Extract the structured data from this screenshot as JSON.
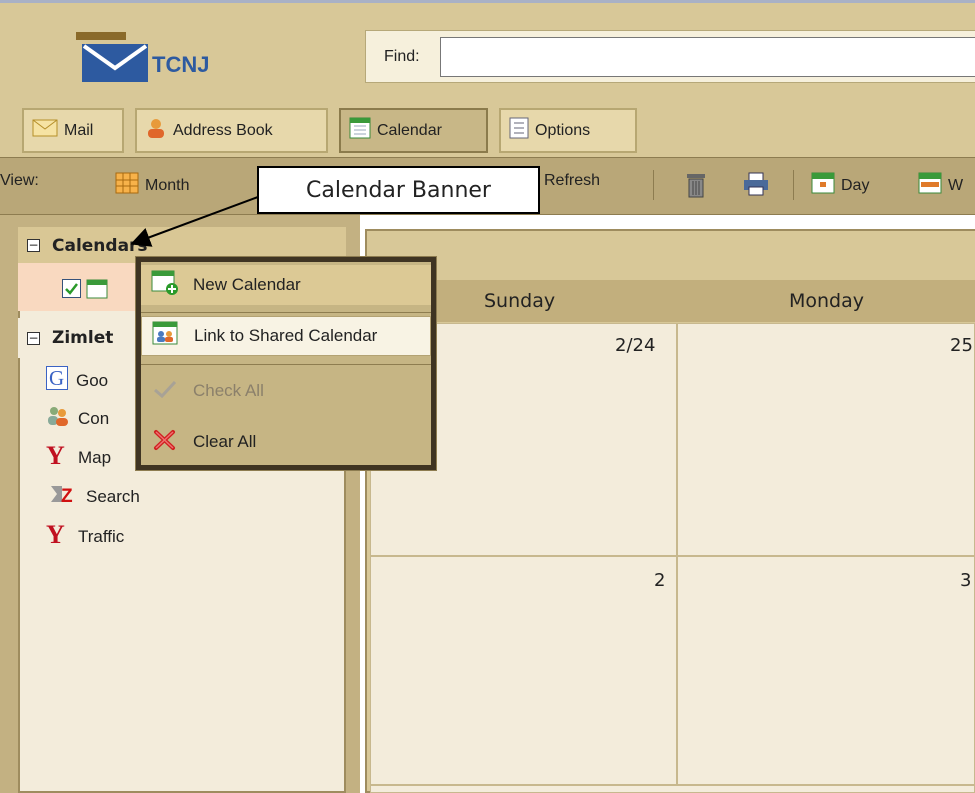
{
  "header": {
    "logo_text": "TCNJ",
    "find_label": "Find:",
    "find_value": ""
  },
  "tabs": [
    {
      "label": "Mail",
      "icon": "envelope-icon"
    },
    {
      "label": "Address Book",
      "icon": "contact-icon"
    },
    {
      "label": "Calendar",
      "icon": "calendar-icon",
      "active": true
    },
    {
      "label": "Options",
      "icon": "options-icon"
    }
  ],
  "toolbar": {
    "view_label": "View:",
    "month_label": "Month",
    "refresh_label": "Refresh",
    "day_label": "Day",
    "week_label": "W"
  },
  "callout": {
    "text": "Calendar Banner"
  },
  "sidebar": {
    "calendars_heading": "Calendars",
    "zimlets_heading": "Zimlet",
    "zimlet_items": [
      "Goo",
      "Con",
      "Map",
      "Search",
      "Traffic"
    ]
  },
  "context_menu": {
    "items": [
      "New Calendar",
      "Link to Shared Calendar",
      "Check All",
      "Clear All"
    ]
  },
  "calendar": {
    "days": [
      "Sunday",
      "Monday"
    ],
    "dates": [
      "2/24",
      "25",
      "2",
      "3"
    ]
  },
  "colors": {
    "tan": "#d8c898",
    "toolbar": "#b9a778",
    "cell": "#f3ecdb",
    "accent_blue": "#2d5aa0",
    "menu_border": "#3f3422"
  }
}
